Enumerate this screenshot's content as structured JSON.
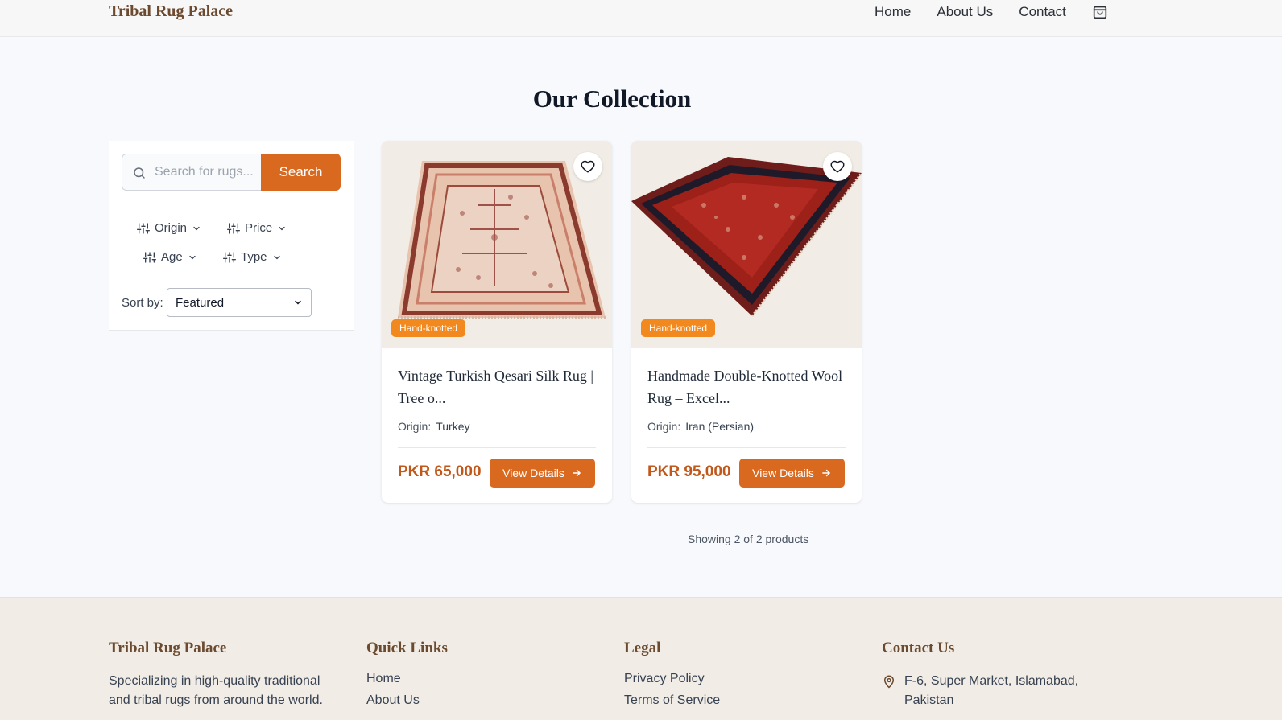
{
  "header": {
    "brand": "Tribal Rug Palace",
    "nav": [
      "Home",
      "About Us",
      "Contact"
    ],
    "cart_icon": "shopping-bag-icon"
  },
  "page_title": "Our Collection",
  "sidebar": {
    "search_placeholder": "Search for rugs...",
    "search_button": "Search",
    "filters": [
      "Origin",
      "Price",
      "Age",
      "Type"
    ],
    "sort_label": "Sort by:",
    "sort_value": "Featured"
  },
  "products": [
    {
      "title": "Vintage Turkish Qesari Silk Rug | Tree o...",
      "tag": "Hand-knotted",
      "origin_label": "Origin:",
      "origin": "Turkey",
      "price": "PKR 65,000",
      "button": "View Details"
    },
    {
      "title": "Handmade Double-Knotted Wool Rug – Excel...",
      "tag": "Hand-knotted",
      "origin_label": "Origin:",
      "origin": "Iran (Persian)",
      "price": "PKR 95,000",
      "button": "View Details"
    }
  ],
  "showing": "Showing 2 of 2 products",
  "footer": {
    "brand": "Tribal Rug Palace",
    "description": "Specializing in high-quality traditional and tribal rugs from around the world.",
    "quick_links_title": "Quick Links",
    "quick_links": [
      "Home",
      "About Us"
    ],
    "legal_title": "Legal",
    "legal_links": [
      "Privacy Policy",
      "Terms of Service"
    ],
    "contact_title": "Contact Us",
    "address": "F-6, Super Market, Islamabad, Pakistan"
  },
  "colors": {
    "accent": "#d9691f",
    "brand": "#6b4a2f",
    "tag": "#f2891f",
    "price": "#c2571a"
  }
}
